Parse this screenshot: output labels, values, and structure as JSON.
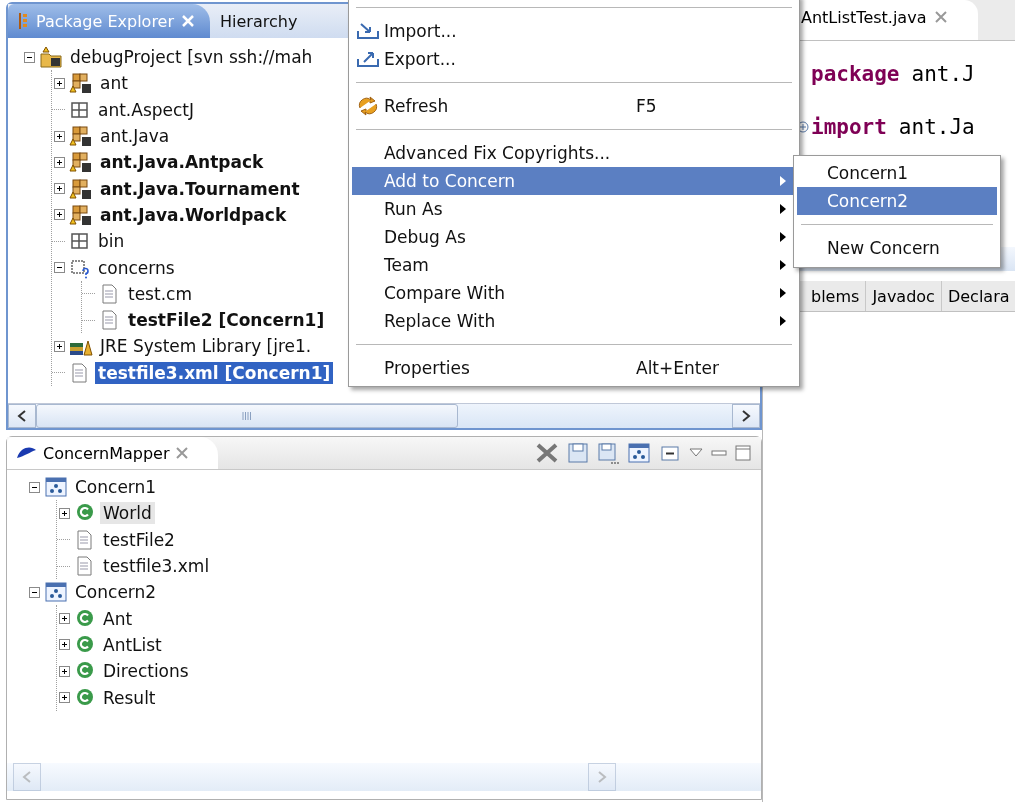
{
  "package_explorer": {
    "tabs": [
      {
        "label": "Package Explorer",
        "selected": true
      },
      {
        "label": "Hierarchy",
        "selected": false
      }
    ],
    "tree": [
      {
        "label": "debugProject [svn ssh://mah",
        "kind": "project",
        "expanded": true,
        "bold": false,
        "selected": false,
        "children": [
          {
            "label": "ant",
            "kind": "package",
            "expanded": false,
            "bold": false,
            "selected": false
          },
          {
            "label": "ant.AspectJ",
            "kind": "source-folder",
            "bold": false,
            "selected": false
          },
          {
            "label": "ant.Java",
            "kind": "package",
            "expanded": false,
            "bold": false,
            "selected": false
          },
          {
            "label": "ant.Java.Antpack",
            "kind": "package",
            "expanded": false,
            "bold": true,
            "selected": false
          },
          {
            "label": "ant.Java.Tournament",
            "kind": "package",
            "expanded": false,
            "bold": true,
            "selected": false
          },
          {
            "label": "ant.Java.Worldpack",
            "kind": "package",
            "expanded": false,
            "bold": true,
            "selected": false
          },
          {
            "label": "bin",
            "kind": "source-folder",
            "bold": false,
            "selected": false
          },
          {
            "label": "concerns",
            "kind": "concern-folder",
            "expanded": true,
            "bold": false,
            "selected": false,
            "children": [
              {
                "label": "test.cm",
                "kind": "file",
                "bold": false,
                "selected": false
              },
              {
                "label": "testFile2 [Concern1]",
                "kind": "file",
                "bold": true,
                "selected": false
              }
            ]
          },
          {
            "label": "JRE System Library [jre1.",
            "kind": "library",
            "expanded": false,
            "bold": false,
            "selected": false
          },
          {
            "label": "testfile3.xml [Concern1]",
            "kind": "file",
            "bold": true,
            "selected": true
          }
        ]
      }
    ]
  },
  "concern_mapper": {
    "title": "ConcernMapper",
    "tree": [
      {
        "label": "Concern1",
        "kind": "concern",
        "expanded": true,
        "highlighted": false,
        "children": [
          {
            "label": "World",
            "kind": "class",
            "expanded": false,
            "highlighted": true
          },
          {
            "label": "testFile2",
            "kind": "file",
            "highlighted": false
          },
          {
            "label": "testfile3.xml",
            "kind": "file",
            "highlighted": false
          }
        ]
      },
      {
        "label": "Concern2",
        "kind": "concern",
        "expanded": true,
        "highlighted": false,
        "children": [
          {
            "label": "Ant",
            "kind": "class",
            "expanded": false,
            "highlighted": false
          },
          {
            "label": "AntList",
            "kind": "class",
            "expanded": false,
            "highlighted": false
          },
          {
            "label": "Directions",
            "kind": "class",
            "expanded": false,
            "highlighted": false
          },
          {
            "label": "Result",
            "kind": "class",
            "expanded": false,
            "highlighted": false
          }
        ]
      }
    ]
  },
  "editor": {
    "tab": "AntListTest.java",
    "lines": [
      {
        "keyword": "package",
        "rest": "ant.J"
      },
      {
        "keyword": "import",
        "rest": "ant.Ja",
        "folded": true
      }
    ],
    "bottom_tabs": [
      "blems",
      "Javadoc",
      "Declara"
    ]
  },
  "context_menu": {
    "items": [
      {
        "kind": "separator"
      },
      {
        "kind": "item",
        "label": "Import...",
        "selected": false
      },
      {
        "kind": "item",
        "label": "Export...",
        "selected": false
      },
      {
        "kind": "separator"
      },
      {
        "kind": "item",
        "label": "Refresh",
        "shortcut": "F5",
        "selected": false
      },
      {
        "kind": "separator"
      },
      {
        "kind": "item",
        "label": "Advanced Fix Copyrights...",
        "selected": false
      },
      {
        "kind": "item",
        "label": "Add to Concern",
        "submenu": true,
        "selected": true
      },
      {
        "kind": "item",
        "label": "Run As",
        "submenu": true,
        "selected": false
      },
      {
        "kind": "item",
        "label": "Debug As",
        "submenu": true,
        "selected": false
      },
      {
        "kind": "item",
        "label": "Team",
        "submenu": true,
        "selected": false
      },
      {
        "kind": "item",
        "label": "Compare With",
        "submenu": true,
        "selected": false
      },
      {
        "kind": "item",
        "label": "Replace With",
        "submenu": true,
        "selected": false
      },
      {
        "kind": "separator"
      },
      {
        "kind": "item",
        "label": "Properties",
        "shortcut": "Alt+Enter",
        "selected": false
      }
    ]
  },
  "submenu": {
    "items": [
      {
        "kind": "item",
        "label": "Concern1",
        "selected": false
      },
      {
        "kind": "item",
        "label": "Concern2",
        "selected": true
      },
      {
        "kind": "separator"
      },
      {
        "kind": "item",
        "label": "New Concern",
        "selected": false
      }
    ]
  }
}
